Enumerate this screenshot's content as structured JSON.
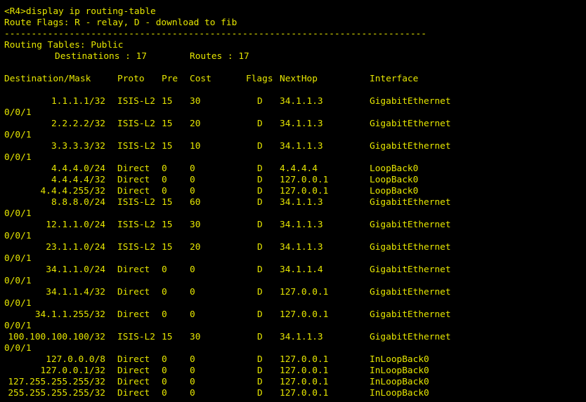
{
  "prompt_line": "<R4>display ip routing-table",
  "flags_line": "Route Flags: R - relay, D - download to fib",
  "separator": "------------------------------------------------------------------------------",
  "tables_line": "Routing Tables: Public",
  "destinations_label": "Destinations : 17",
  "routes_label": "Routes : 17",
  "columns": {
    "dest": "Destination/Mask",
    "proto": "Proto",
    "pre": "Pre",
    "cost": "Cost",
    "flags": "Flags",
    "nexthop": "NextHop",
    "interface": "Interface"
  },
  "routes": [
    {
      "dest": "1.1.1.1/32",
      "proto": "ISIS-L2",
      "pre": "15",
      "cost": "30",
      "flags": "D",
      "nexthop": "34.1.1.3",
      "interface": "GigabitEthernet",
      "wrap": "0/0/1"
    },
    {
      "dest": "2.2.2.2/32",
      "proto": "ISIS-L2",
      "pre": "15",
      "cost": "20",
      "flags": "D",
      "nexthop": "34.1.1.3",
      "interface": "GigabitEthernet",
      "wrap": "0/0/1"
    },
    {
      "dest": "3.3.3.3/32",
      "proto": "ISIS-L2",
      "pre": "15",
      "cost": "10",
      "flags": "D",
      "nexthop": "34.1.1.3",
      "interface": "GigabitEthernet",
      "wrap": "0/0/1"
    },
    {
      "dest": "4.4.4.0/24",
      "proto": "Direct",
      "pre": "0",
      "cost": "0",
      "flags": "D",
      "nexthop": "4.4.4.4",
      "interface": "LoopBack0",
      "wrap": ""
    },
    {
      "dest": "4.4.4.4/32",
      "proto": "Direct",
      "pre": "0",
      "cost": "0",
      "flags": "D",
      "nexthop": "127.0.0.1",
      "interface": "LoopBack0",
      "wrap": ""
    },
    {
      "dest": "4.4.4.255/32",
      "proto": "Direct",
      "pre": "0",
      "cost": "0",
      "flags": "D",
      "nexthop": "127.0.0.1",
      "interface": "LoopBack0",
      "wrap": ""
    },
    {
      "dest": "8.8.8.0/24",
      "proto": "ISIS-L2",
      "pre": "15",
      "cost": "60",
      "flags": "D",
      "nexthop": "34.1.1.3",
      "interface": "GigabitEthernet",
      "wrap": "0/0/1"
    },
    {
      "dest": "12.1.1.0/24",
      "proto": "ISIS-L2",
      "pre": "15",
      "cost": "30",
      "flags": "D",
      "nexthop": "34.1.1.3",
      "interface": "GigabitEthernet",
      "wrap": "0/0/1"
    },
    {
      "dest": "23.1.1.0/24",
      "proto": "ISIS-L2",
      "pre": "15",
      "cost": "20",
      "flags": "D",
      "nexthop": "34.1.1.3",
      "interface": "GigabitEthernet",
      "wrap": "0/0/1"
    },
    {
      "dest": "34.1.1.0/24",
      "proto": "Direct",
      "pre": "0",
      "cost": "0",
      "flags": "D",
      "nexthop": "34.1.1.4",
      "interface": "GigabitEthernet",
      "wrap": "0/0/1"
    },
    {
      "dest": "34.1.1.4/32",
      "proto": "Direct",
      "pre": "0",
      "cost": "0",
      "flags": "D",
      "nexthop": "127.0.0.1",
      "interface": "GigabitEthernet",
      "wrap": "0/0/1"
    },
    {
      "dest": "34.1.1.255/32",
      "proto": "Direct",
      "pre": "0",
      "cost": "0",
      "flags": "D",
      "nexthop": "127.0.0.1",
      "interface": "GigabitEthernet",
      "wrap": "0/0/1"
    },
    {
      "dest": "100.100.100.100/32",
      "proto": "ISIS-L2",
      "pre": "15",
      "cost": "30",
      "flags": "D",
      "nexthop": "34.1.1.3",
      "interface": "GigabitEthernet",
      "wrap": "0/0/1"
    },
    {
      "dest": "127.0.0.0/8",
      "proto": "Direct",
      "pre": "0",
      "cost": "0",
      "flags": "D",
      "nexthop": "127.0.0.1",
      "interface": "InLoopBack0",
      "wrap": ""
    },
    {
      "dest": "127.0.0.1/32",
      "proto": "Direct",
      "pre": "0",
      "cost": "0",
      "flags": "D",
      "nexthop": "127.0.0.1",
      "interface": "InLoopBack0",
      "wrap": ""
    },
    {
      "dest": "127.255.255.255/32",
      "proto": "Direct",
      "pre": "0",
      "cost": "0",
      "flags": "D",
      "nexthop": "127.0.0.1",
      "interface": "InLoopBack0",
      "wrap": ""
    },
    {
      "dest": "255.255.255.255/32",
      "proto": "Direct",
      "pre": "0",
      "cost": "0",
      "flags": "D",
      "nexthop": "127.0.0.1",
      "interface": "InLoopBack0",
      "wrap": ""
    }
  ]
}
